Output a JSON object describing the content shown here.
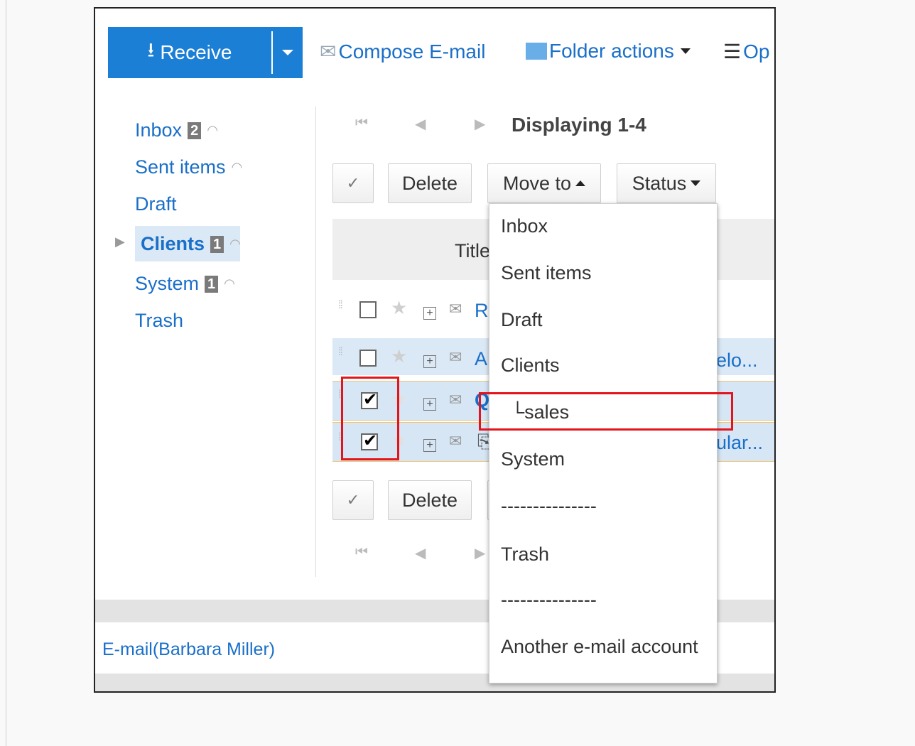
{
  "toolbar": {
    "receive_label": "Receive",
    "compose_label": "Compose E-mail",
    "folder_actions_label": "Folder actions",
    "options_label": "Op"
  },
  "sidebar": {
    "folders": [
      {
        "label": "Inbox",
        "badge": "2",
        "rss": true
      },
      {
        "label": "Sent items",
        "badge": "",
        "rss": true
      },
      {
        "label": "Draft",
        "badge": "",
        "rss": false
      },
      {
        "label": "Clients",
        "badge": "1",
        "rss": true,
        "selected": true,
        "expandable": true
      },
      {
        "label": "System",
        "badge": "1",
        "rss": true
      },
      {
        "label": "Trash",
        "badge": "",
        "rss": false
      }
    ]
  },
  "pager": {
    "display_text": "Displaying 1-4"
  },
  "actions": {
    "check_all": "✓",
    "delete_label": "Delete",
    "move_to_label": "Move to",
    "status_label": "Status"
  },
  "table": {
    "title_header": "Title",
    "rows": [
      {
        "subject": "R",
        "checked": false
      },
      {
        "subject": "A",
        "checked": false,
        "trailing": "elo..."
      },
      {
        "subject": "Q",
        "checked": true
      },
      {
        "subject": "",
        "checked": true,
        "trailing": "ular..."
      }
    ]
  },
  "move_to_menu": {
    "items": [
      "Inbox",
      "Sent items",
      "Draft",
      "Clients",
      "└sales",
      "System",
      "---------------",
      "Trash",
      "---------------",
      "Another e-mail account"
    ],
    "highlighted": "└sales"
  },
  "footer": {
    "account_label": "E-mail(Barbara Miller)"
  },
  "colors": {
    "primary": "#1b7fd6",
    "link": "#1a6fc9",
    "annotation": "#e3141b",
    "selection": "#dbe9f6"
  }
}
